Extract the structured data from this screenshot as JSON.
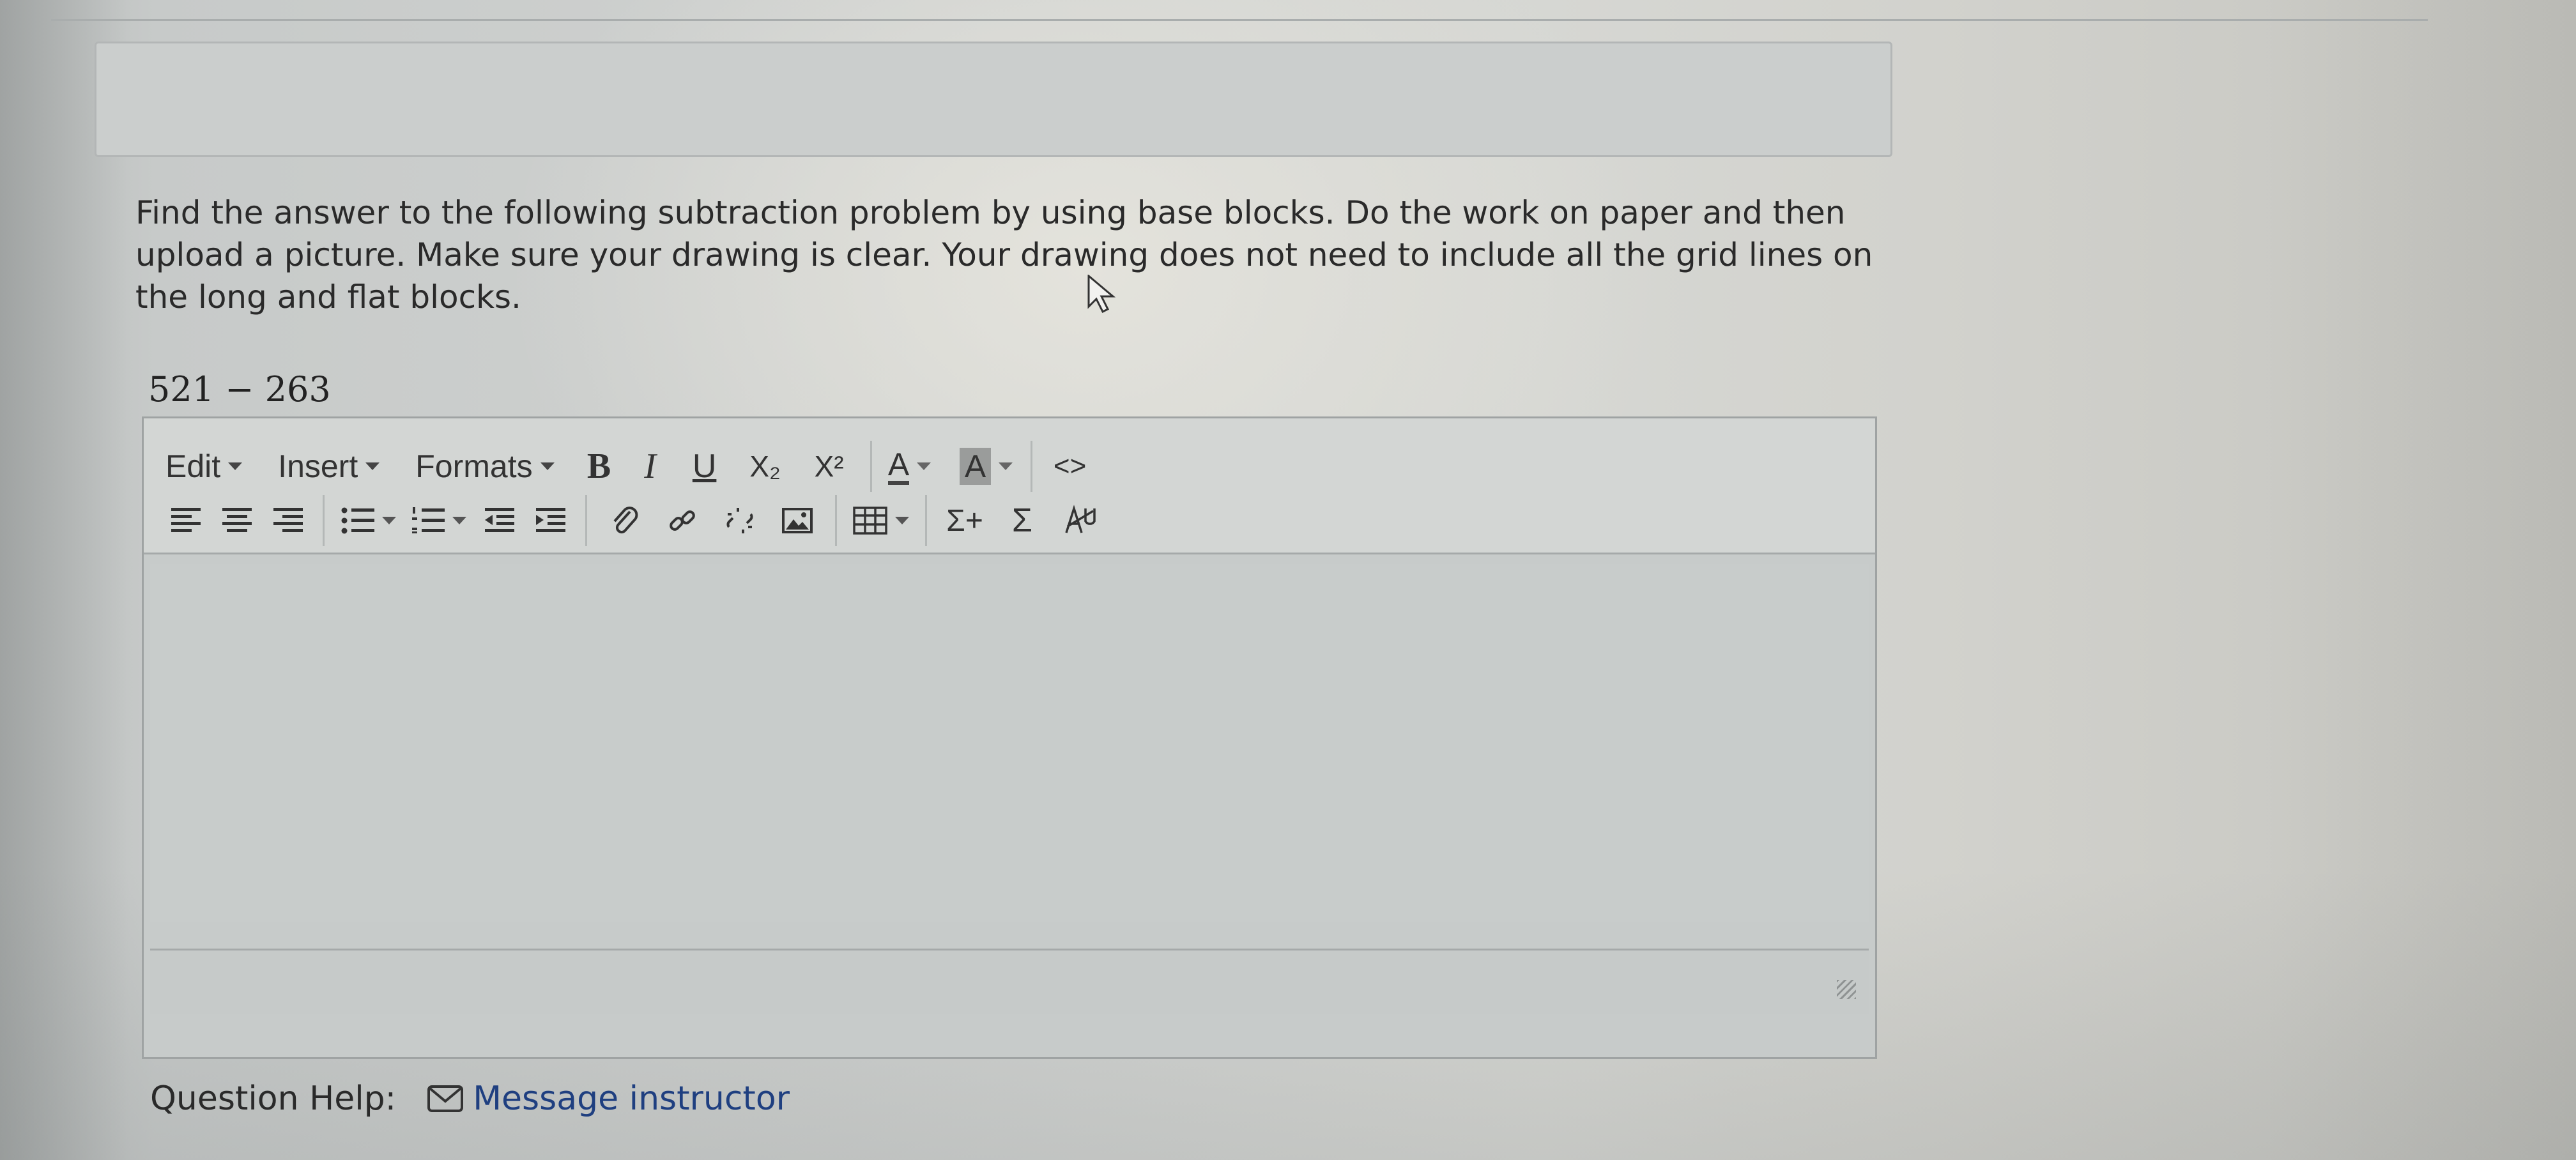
{
  "question": {
    "text": "Find the answer to the following subtraction problem by using base blocks. Do the work on paper and then upload a picture. Make sure your drawing is clear.  Your drawing does not need to include all the grid lines on the long and flat blocks.",
    "expression": "521 − 263"
  },
  "editor": {
    "menus": [
      "Edit",
      "Insert",
      "Formats"
    ],
    "toolbar_row1": [
      {
        "name": "bold-button",
        "label": "B"
      },
      {
        "name": "italic-button",
        "label": "I"
      },
      {
        "name": "underline-button",
        "label": "U"
      },
      {
        "name": "subscript-button",
        "label": "X₂"
      },
      {
        "name": "superscript-button",
        "label": "X²"
      },
      {
        "name": "text-color-button",
        "label": "A"
      },
      {
        "name": "background-color-button",
        "label": "A"
      },
      {
        "name": "source-code-button",
        "label": "<>"
      }
    ],
    "toolbar_row2_icons": [
      "align-left-icon",
      "align-center-icon",
      "align-right-icon",
      "bullet-list-icon",
      "numbered-list-icon",
      "outdent-icon",
      "indent-icon",
      "attachment-icon",
      "link-icon",
      "unlink-icon",
      "image-icon",
      "table-icon",
      "equation-plus-icon",
      "sigma-icon",
      "special-char-icon"
    ],
    "math_labels": {
      "sum_plus": "Σ+",
      "sum": "Σ"
    }
  },
  "help": {
    "label": "Question Help:",
    "link": "Message instructor"
  },
  "colors": {
    "link": "#1f3f80",
    "toolbar_bg": "#d3d6d4",
    "editor_border": "#9fa3a3"
  }
}
